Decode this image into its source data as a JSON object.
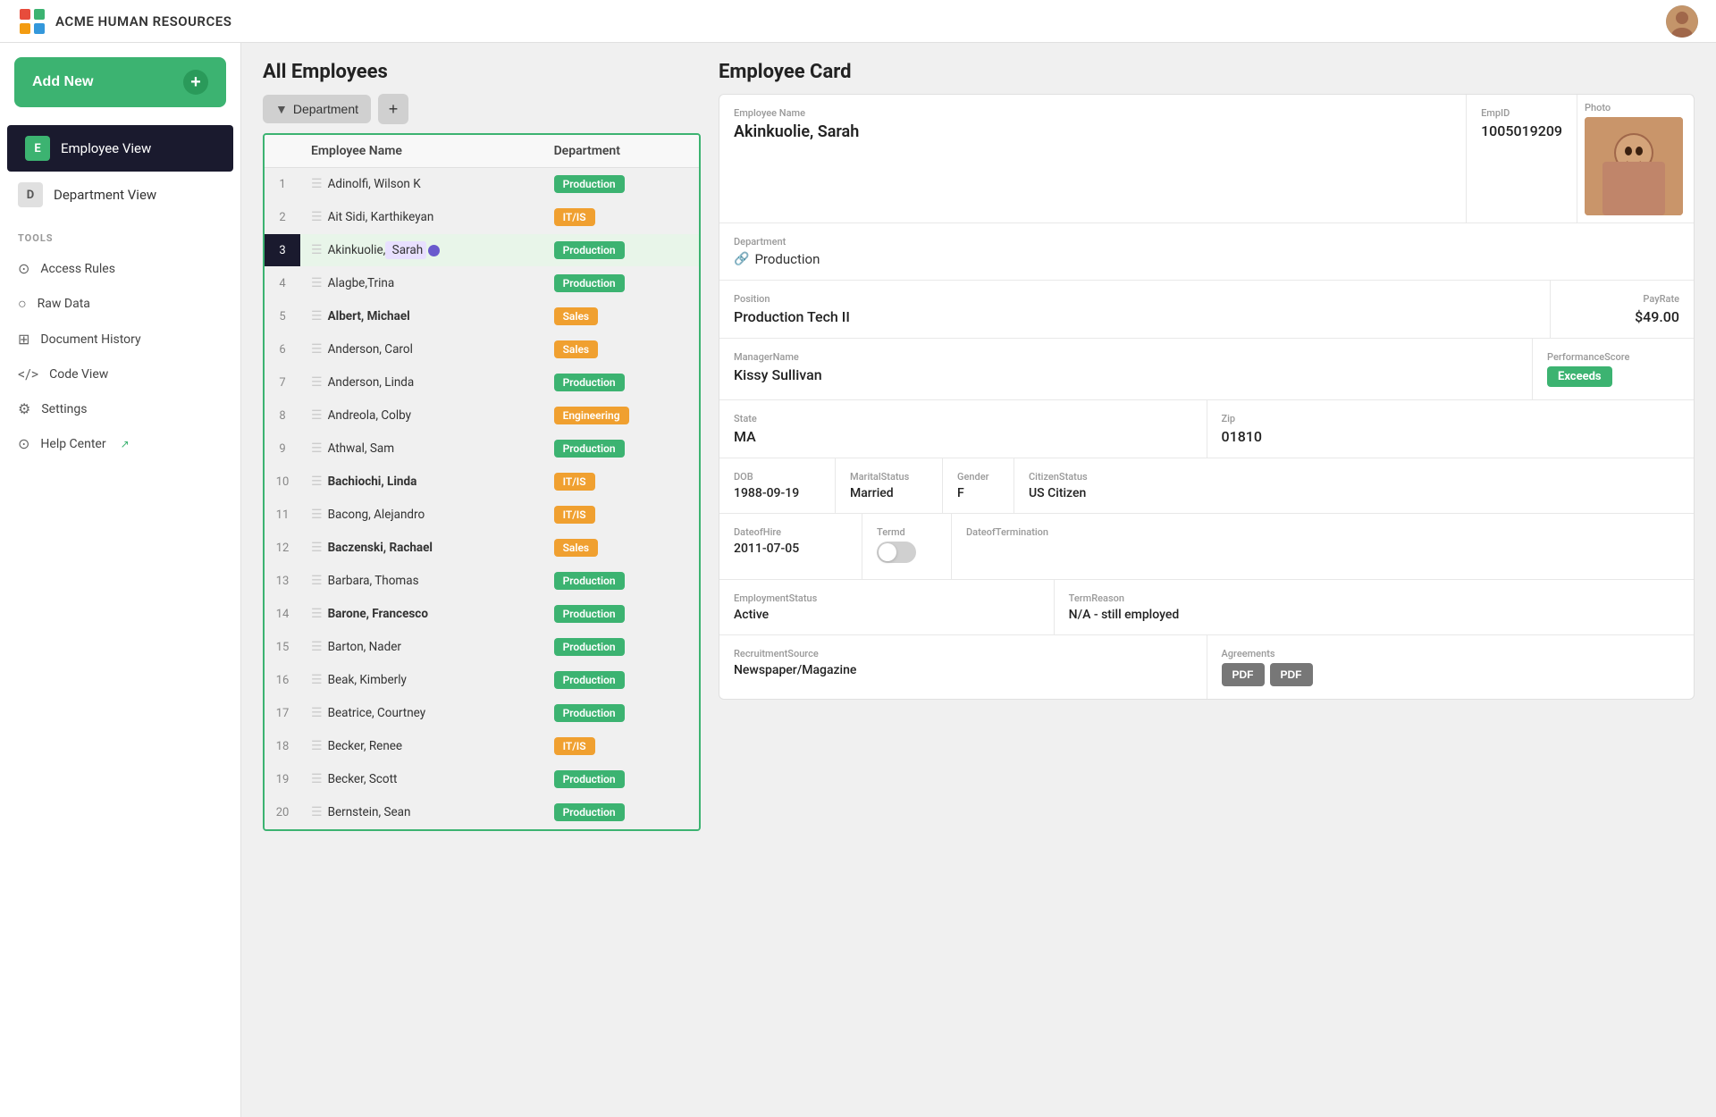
{
  "app": {
    "title": "ACME Human Resources"
  },
  "sidebar": {
    "add_new_label": "Add New",
    "nav_items": [
      {
        "id": "employee-view",
        "icon": "E",
        "label": "Employee View",
        "active": true
      },
      {
        "id": "department-view",
        "icon": "D",
        "label": "Department View",
        "active": false
      }
    ],
    "tools_label": "TOOLS",
    "tools_items": [
      {
        "id": "access-rules",
        "icon": "⊙",
        "label": "Access Rules"
      },
      {
        "id": "raw-data",
        "icon": "○",
        "label": "Raw Data"
      },
      {
        "id": "document-history",
        "icon": "⊞",
        "label": "Document History"
      },
      {
        "id": "code-view",
        "icon": "</>",
        "label": "Code View"
      },
      {
        "id": "settings",
        "icon": "⚙",
        "label": "Settings"
      },
      {
        "id": "help-center",
        "icon": "⊙",
        "label": "Help Center",
        "external": true
      }
    ]
  },
  "employee_list": {
    "title": "All Employees",
    "filter_label": "Department",
    "columns": [
      "Employee Name",
      "Department"
    ],
    "rows": [
      {
        "num": 1,
        "name": "Adinolfi, Wilson  K",
        "dept": "Production",
        "dept_type": "production",
        "bold": false
      },
      {
        "num": 2,
        "name": "Ait Sidi, Karthikeyan",
        "dept": "IT/IS",
        "dept_type": "itis",
        "bold": false
      },
      {
        "num": 3,
        "name": "Akinkuolie, Sarah",
        "dept": "Production",
        "dept_type": "production",
        "bold": false,
        "selected": true
      },
      {
        "num": 4,
        "name": "Alagbe,Trina",
        "dept": "Production",
        "dept_type": "production",
        "bold": false
      },
      {
        "num": 5,
        "name": "Albert, Michael",
        "dept": "Sales",
        "dept_type": "sales",
        "bold": true
      },
      {
        "num": 6,
        "name": "Anderson, Carol",
        "dept": "Sales",
        "dept_type": "sales",
        "bold": false
      },
      {
        "num": 7,
        "name": "Anderson, Linda",
        "dept": "Production",
        "dept_type": "production",
        "bold": false
      },
      {
        "num": 8,
        "name": "Andreola, Colby",
        "dept": "Engineering",
        "dept_type": "engineering",
        "bold": false
      },
      {
        "num": 9,
        "name": "Athwal, Sam",
        "dept": "Production",
        "dept_type": "production",
        "bold": false
      },
      {
        "num": 10,
        "name": "Bachiochi, Linda",
        "dept": "IT/IS",
        "dept_type": "itis",
        "bold": true
      },
      {
        "num": 11,
        "name": "Bacong, Alejandro",
        "dept": "IT/IS",
        "dept_type": "itis",
        "bold": false
      },
      {
        "num": 12,
        "name": "Baczenski, Rachael",
        "dept": "Sales",
        "dept_type": "sales",
        "bold": true
      },
      {
        "num": 13,
        "name": "Barbara, Thomas",
        "dept": "Production",
        "dept_type": "production",
        "bold": false
      },
      {
        "num": 14,
        "name": "Barone, Francesco",
        "dept": "Production",
        "dept_type": "production",
        "bold": true
      },
      {
        "num": 15,
        "name": "Barton, Nader",
        "dept": "Production",
        "dept_type": "production",
        "bold": false
      },
      {
        "num": 16,
        "name": "Beak, Kimberly",
        "dept": "Production",
        "dept_type": "production",
        "bold": false
      },
      {
        "num": 17,
        "name": "Beatrice, Courtney",
        "dept": "Production",
        "dept_type": "production",
        "bold": false
      },
      {
        "num": 18,
        "name": "Becker, Renee",
        "dept": "IT/IS",
        "dept_type": "itis",
        "bold": false
      },
      {
        "num": 19,
        "name": "Becker, Scott",
        "dept": "Production",
        "dept_type": "production",
        "bold": false
      },
      {
        "num": 20,
        "name": "Bernstein, Sean",
        "dept": "Production",
        "dept_type": "production",
        "bold": false
      }
    ]
  },
  "employee_card": {
    "title": "Employee Card",
    "labels": {
      "employee_name": "Employee Name",
      "emp_id": "EmpID",
      "photo": "Photo",
      "department": "Department",
      "position": "Position",
      "pay_rate": "PayRate",
      "manager_name": "ManagerName",
      "performance_score": "PerformanceScore",
      "state": "State",
      "zip": "Zip",
      "dob": "DOB",
      "marital_status": "MaritalStatus",
      "gender": "Gender",
      "citizen_status": "CitizenStatus",
      "date_of_hire": "DateofHire",
      "termd": "Termd",
      "date_of_termination": "DateofTermination",
      "employment_status": "EmploymentStatus",
      "term_reason": "TermReason",
      "recruitment_source": "RecruitmentSource",
      "agreements": "Agreements"
    },
    "values": {
      "employee_name": "Akinkuolie, Sarah",
      "emp_id": "1005019209",
      "department": "Production",
      "position": "Production Tech II",
      "pay_rate": "$49.00",
      "manager_name": "Kissy Sullivan",
      "performance_score": "Exceeds",
      "state": "MA",
      "zip": "01810",
      "dob": "1988-09-19",
      "marital_status": "Married",
      "gender": "F",
      "citizen_status": "US Citizen",
      "date_of_hire": "2011-07-05",
      "termd": false,
      "date_of_termination": "",
      "employment_status": "Active",
      "term_reason": "N/A - still employed",
      "recruitment_source": "Newspaper/Magazine",
      "agreements_btn1": "PDF",
      "agreements_btn2": "PDF"
    }
  }
}
